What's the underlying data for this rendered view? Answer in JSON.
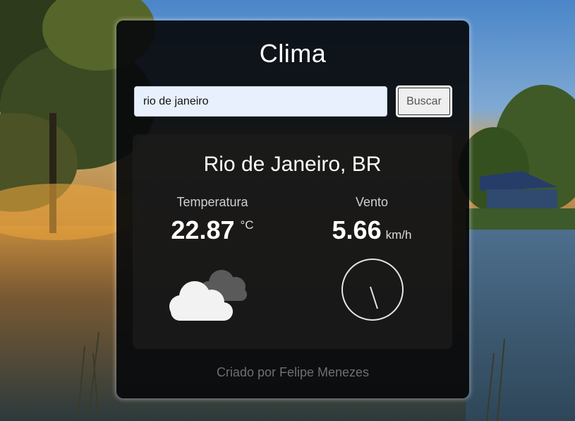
{
  "app": {
    "title": "Clima"
  },
  "search": {
    "value": "rio de janeiro",
    "button_label": "Buscar"
  },
  "weather": {
    "city": "Rio de Janeiro, BR",
    "temperature_label": "Temperatura",
    "temperature_value": "22.87",
    "temperature_unit": "°C",
    "wind_label": "Vento",
    "wind_value": "5.66",
    "wind_unit": "km/h",
    "condition_icon": "cloudy-icon",
    "wind_icon": "wind-direction-gauge-icon"
  },
  "footer": {
    "credit": "Criado por Felipe Menezes"
  },
  "colors": {
    "card_bg": "#0a0c0e",
    "text": "#ffffff",
    "muted": "#6f6f6f",
    "input_bg": "#e8f0fe"
  }
}
